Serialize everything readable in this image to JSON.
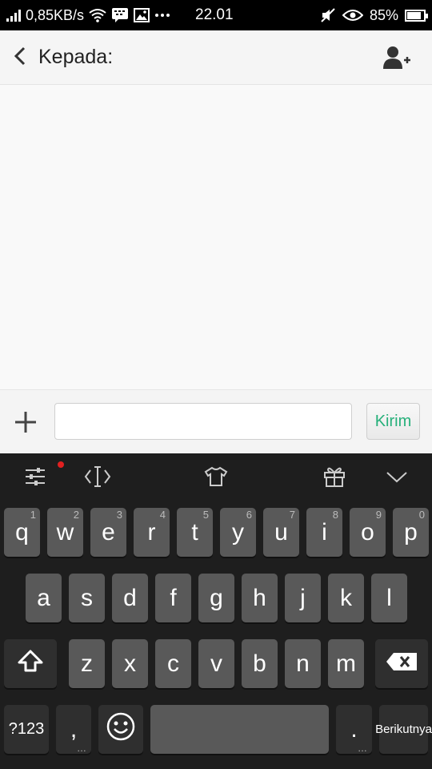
{
  "status_bar": {
    "speed": "0,85KB/s",
    "time": "22.01",
    "battery": "85%",
    "battery_level": 0.85,
    "icons": [
      "signal-icon",
      "wifi-icon",
      "bbm-icon",
      "image-icon",
      "more-icon",
      "mute-icon",
      "eye-icon",
      "battery-icon"
    ]
  },
  "header": {
    "to_label": "Kepada:",
    "back_icon": "chevron-left-icon",
    "add_contact_icon": "add-contact-icon"
  },
  "compose": {
    "input_value": "",
    "send_label": "Kirim",
    "accent": "#26b07a"
  },
  "keyboard": {
    "toolbar_icons": [
      "settings-sliders-icon",
      "cursor-icon",
      "theme-shirt-icon",
      "gift-icon",
      "hide-keyboard-icon"
    ],
    "row1": [
      {
        "label": "q",
        "hint": "1"
      },
      {
        "label": "w",
        "hint": "2"
      },
      {
        "label": "e",
        "hint": "3"
      },
      {
        "label": "r",
        "hint": "4"
      },
      {
        "label": "t",
        "hint": "5"
      },
      {
        "label": "y",
        "hint": "6"
      },
      {
        "label": "u",
        "hint": "7"
      },
      {
        "label": "i",
        "hint": "8"
      },
      {
        "label": "o",
        "hint": "9"
      },
      {
        "label": "p",
        "hint": "0"
      }
    ],
    "row2": [
      "a",
      "s",
      "d",
      "f",
      "g",
      "h",
      "j",
      "k",
      "l"
    ],
    "row3": [
      "z",
      "x",
      "c",
      "v",
      "b",
      "n",
      "m"
    ],
    "symbols_label": "?123",
    "comma_label": ",",
    "period_label": ".",
    "next_label": "Berikutnya"
  }
}
